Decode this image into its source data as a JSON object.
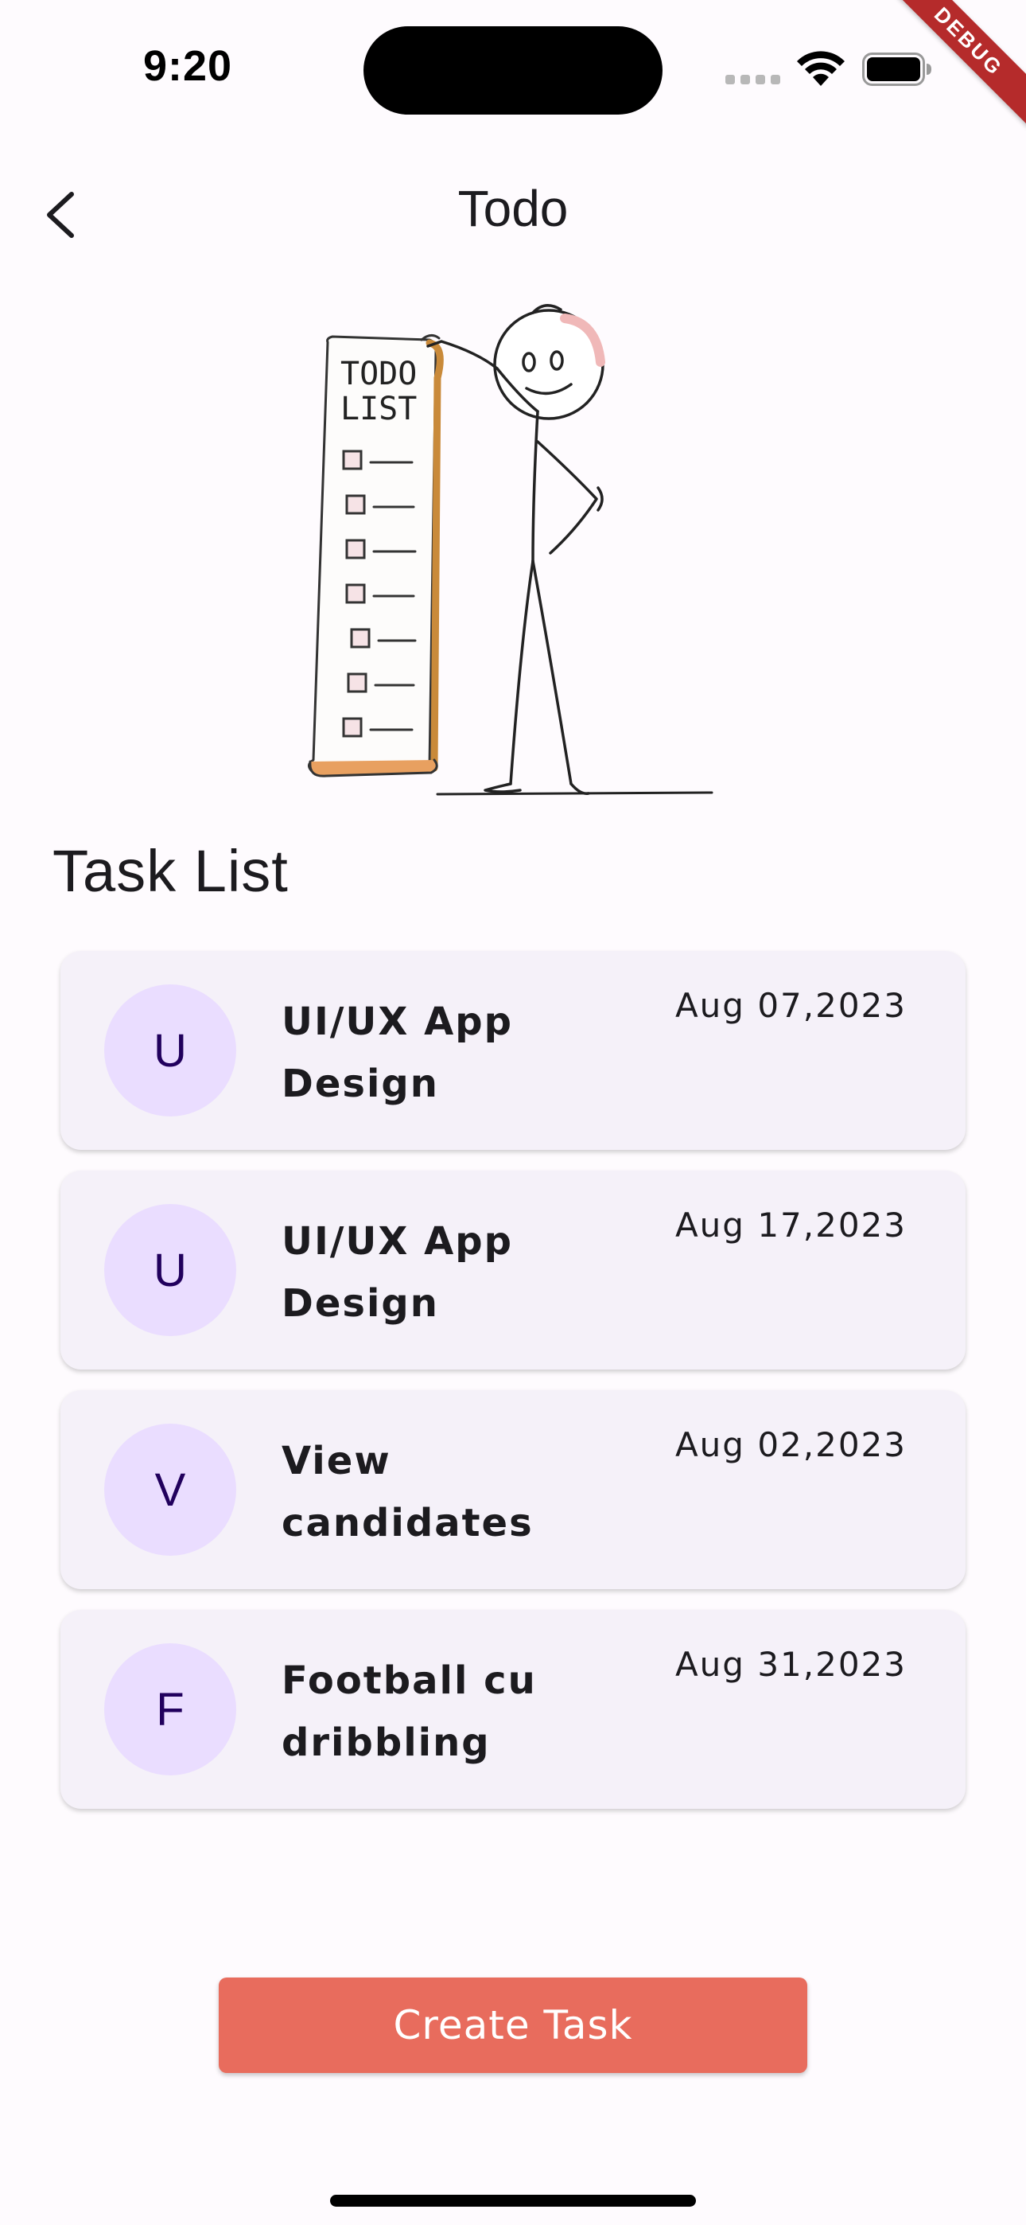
{
  "status_bar": {
    "time": "9:20",
    "debug_label": "DEBUG"
  },
  "app_bar": {
    "title": "Todo",
    "back_icon": "chevron-left-icon"
  },
  "illustration": {
    "icon": "todo-list-stick-figure-illustration",
    "scroll_text_line1": "TODO",
    "scroll_text_line2": "LIST"
  },
  "section": {
    "title": "Task List"
  },
  "tasks": [
    {
      "initial": "U",
      "name": "UI/UX App Design",
      "date": "Aug 07,2023"
    },
    {
      "initial": "U",
      "name": "UI/UX App Design",
      "date": "Aug 17,2023"
    },
    {
      "initial": "V",
      "name": "View candidates",
      "date": "Aug 02,2023"
    },
    {
      "initial": "F",
      "name": "Football cu dribbling",
      "date": "Aug 31,2023"
    }
  ],
  "create_button": {
    "label": "Create Task"
  },
  "colors": {
    "background": "#fefbfe",
    "card": "#f5f1f9",
    "avatar": "#eaddff",
    "avatar_text": "#21005d",
    "accent": "#e86c5d",
    "debug_banner": "#b52b2b"
  }
}
